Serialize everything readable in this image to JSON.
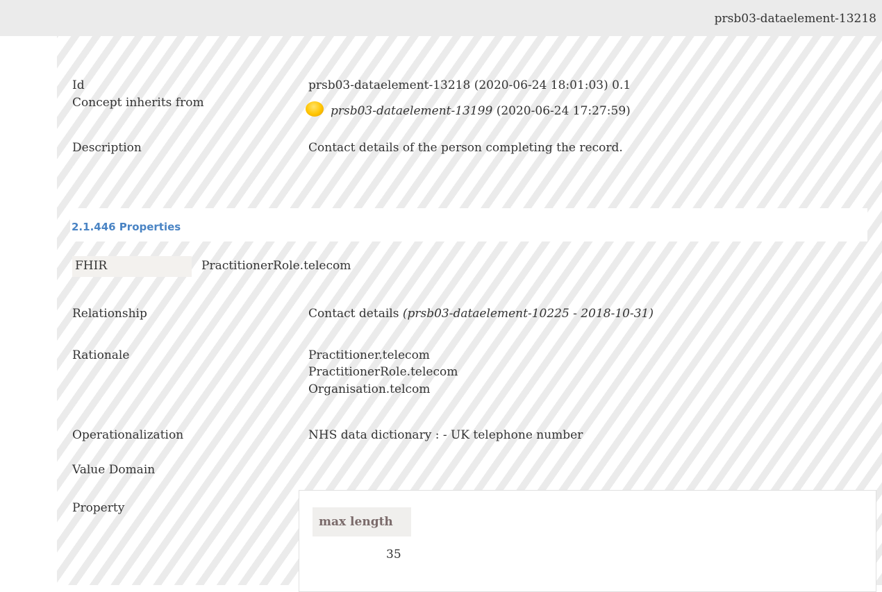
{
  "header": {
    "element_id": "prsb03-dataelement-13218"
  },
  "details": {
    "id_label": "Id",
    "id_value": "prsb03-dataelement-13218 (2020-06-24 18:01:03) 0.1",
    "inherits_label": "Concept inherits from",
    "inherits_link": "prsb03-dataelement-13199",
    "inherits_date": " (2020-06-24 17:27:59)",
    "description_label": "Description",
    "description_value": "Contact details of the person completing the record."
  },
  "properties_section": {
    "title": "2.1.446 Properties",
    "fhir_label": "FHIR",
    "fhir_value": "PractitionerRole.telecom",
    "relationship_label": "Relationship",
    "relationship_value": "Contact details ",
    "relationship_ref": "(prsb03-dataelement-10225 - 2018-10-31)",
    "rationale_label": "Rationale",
    "rationale_lines": [
      "Practitioner.telecom",
      "PractitionerRole.telecom",
      "Organisation.telcom"
    ],
    "operationalization_label": "Operationalization",
    "operationalization_value": "NHS data dictionary : - UK telephone number",
    "value_domain_label": "Value Domain",
    "property_label": "Property",
    "property_table": {
      "header": "max length",
      "value": "35"
    }
  },
  "colors": {
    "section_title": "#4a84c4",
    "status_dot": "#ffc400",
    "stripe": "#ebebeb"
  },
  "icons": {
    "status": "status-dot-yellow-icon"
  }
}
